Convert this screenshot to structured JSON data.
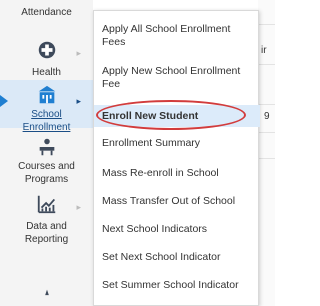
{
  "sidebar": {
    "items": [
      {
        "label": "Attendance",
        "icon": "attendance-icon"
      },
      {
        "label": "Health",
        "icon": "health-icon"
      },
      {
        "label": "School Enrollment",
        "icon": "school-building-icon"
      },
      {
        "label": "Courses and Programs",
        "icon": "teacher-desk-icon"
      },
      {
        "label": "Data and Reporting",
        "icon": "chart-icon"
      }
    ],
    "active_index": 2
  },
  "flyout": {
    "items": [
      {
        "label": "Apply All School Enrollment Fees"
      },
      {
        "label": "Apply New School Enrollment Fee"
      },
      {
        "label": "Enroll New Student"
      },
      {
        "label": "Enrollment Summary"
      },
      {
        "label": "Mass Re-enroll in School"
      },
      {
        "label": "Mass Transfer Out of School"
      },
      {
        "label": "Next School Indicators"
      },
      {
        "label": "Set Next School Indicator"
      },
      {
        "label": "Set Summer School Indicator"
      }
    ],
    "highlighted_index": 2
  },
  "background": {
    "partial_text_1": "ir",
    "partial_text_2": "9"
  },
  "colors": {
    "accent": "#1f7fd1",
    "active_bg": "#dcebfa",
    "annotation_circle": "#d23c3c",
    "sidebar_bg": "#f4f4f4"
  }
}
